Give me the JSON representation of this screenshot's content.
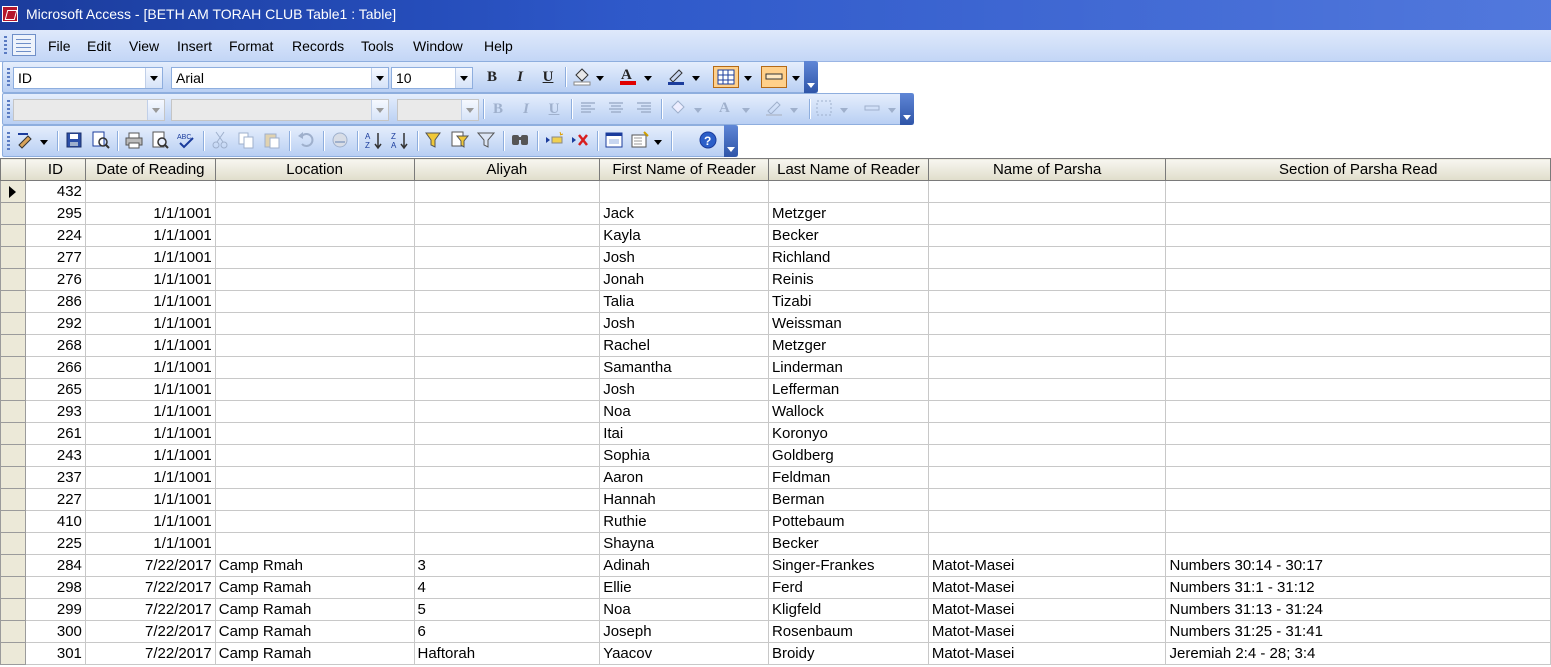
{
  "window": {
    "title": "Microsoft Access - [BETH AM TORAH CLUB Table1 : Table]"
  },
  "menu": [
    "File",
    "Edit",
    "View",
    "Insert",
    "Format",
    "Records",
    "Tools",
    "Window",
    "Help"
  ],
  "formatting_toolbar": {
    "field_combo": "ID",
    "font_combo": "Arial",
    "size_combo": "10",
    "bold": "B",
    "italic": "I",
    "underline": "U"
  },
  "icons": {
    "fill-color": "paint-bucket-icon",
    "font-color": "font-color-icon",
    "line-color": "line-color-icon",
    "gridlines": "gridlines-icon",
    "special-effect": "special-effect-icon"
  },
  "colors": {
    "font_color_bar": "#e00000",
    "titlebar": "#2a55c8",
    "selected_button": "#ffd08a"
  },
  "table": {
    "columns": [
      "ID",
      "Date of Reading",
      "Location",
      "Aliyah",
      "First Name of Reader",
      "Last Name of Reader",
      "Name of Parsha",
      "Section of Parsha Read"
    ],
    "rows": [
      [
        "432",
        "",
        "",
        "",
        "",
        "",
        "",
        ""
      ],
      [
        "295",
        "1/1/1001",
        "",
        "",
        "Jack",
        "Metzger",
        "",
        ""
      ],
      [
        "224",
        "1/1/1001",
        "",
        "",
        "Kayla",
        "Becker",
        "",
        ""
      ],
      [
        "277",
        "1/1/1001",
        "",
        "",
        "Josh",
        "Richland",
        "",
        ""
      ],
      [
        "276",
        "1/1/1001",
        "",
        "",
        "Jonah",
        "Reinis",
        "",
        ""
      ],
      [
        "286",
        "1/1/1001",
        "",
        "",
        "Talia",
        "Tizabi",
        "",
        ""
      ],
      [
        "292",
        "1/1/1001",
        "",
        "",
        "Josh",
        "Weissman",
        "",
        ""
      ],
      [
        "268",
        "1/1/1001",
        "",
        "",
        "Rachel",
        "Metzger",
        "",
        ""
      ],
      [
        "266",
        "1/1/1001",
        "",
        "",
        "Samantha",
        "Linderman",
        "",
        ""
      ],
      [
        "265",
        "1/1/1001",
        "",
        "",
        "Josh",
        "Lefferman",
        "",
        ""
      ],
      [
        "293",
        "1/1/1001",
        "",
        "",
        "Noa",
        "Wallock",
        "",
        ""
      ],
      [
        "261",
        "1/1/1001",
        "",
        "",
        "Itai",
        "Koronyo",
        "",
        ""
      ],
      [
        "243",
        "1/1/1001",
        "",
        "",
        "Sophia",
        "Goldberg",
        "",
        ""
      ],
      [
        "237",
        "1/1/1001",
        "",
        "",
        "Aaron",
        "Feldman",
        "",
        ""
      ],
      [
        "227",
        "1/1/1001",
        "",
        "",
        "Hannah",
        "Berman",
        "",
        ""
      ],
      [
        "410",
        "1/1/1001",
        "",
        "",
        "Ruthie",
        "Pottebaum",
        "",
        ""
      ],
      [
        "225",
        "1/1/1001",
        "",
        "",
        "Shayna",
        "Becker",
        "",
        ""
      ],
      [
        "284",
        "7/22/2017",
        "Camp Rmah",
        "3",
        "Adinah",
        "Singer-Frankes",
        "Matot-Masei",
        "Numbers 30:14 - 30:17"
      ],
      [
        "298",
        "7/22/2017",
        "Camp Ramah",
        "4",
        "Ellie",
        "Ferd",
        "Matot-Masei",
        "Numbers 31:1 - 31:12"
      ],
      [
        "299",
        "7/22/2017",
        "Camp Ramah",
        "5",
        "Noa",
        "Kligfeld",
        "Matot-Masei",
        "Numbers 31:13 - 31:24"
      ],
      [
        "300",
        "7/22/2017",
        "Camp Ramah",
        "6",
        "Joseph",
        "Rosenbaum",
        "Matot-Masei",
        "Numbers 31:25 - 31:41"
      ],
      [
        "301",
        "7/22/2017",
        "Camp Ramah",
        "Haftorah",
        "Yaacov",
        "Broidy",
        "Matot-Masei",
        "Jeremiah 2:4 - 28; 3:4"
      ]
    ],
    "current_row_index": 0
  }
}
